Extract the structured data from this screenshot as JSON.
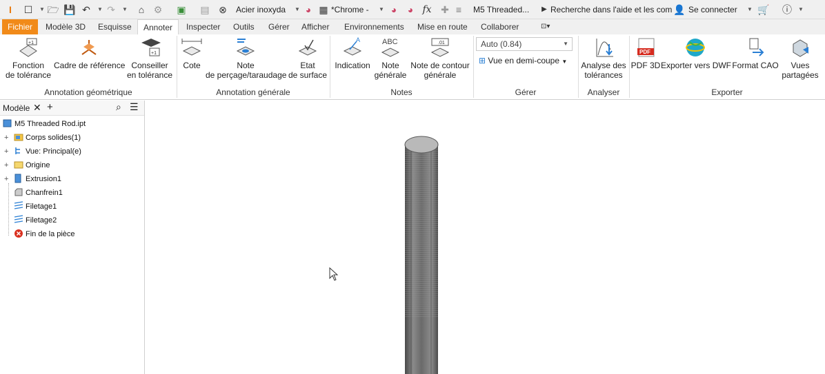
{
  "app": {
    "material": "Acier inoxyda",
    "appearance": "*Chrome -",
    "document_title": "M5 Threaded...",
    "search_placeholder": "Recherche dans l'aide et les com",
    "sign_in": "Se connecter"
  },
  "tabs": [
    "Fichier",
    "Modèle 3D",
    "Esquisse",
    "Annoter",
    "Inspecter",
    "Outils",
    "Gérer",
    "Afficher",
    "Environnements",
    "Mise en route",
    "Collaborer"
  ],
  "active_tab": "Annoter",
  "ribbon": {
    "annotation_geometrique": {
      "title": "Annotation géométrique",
      "buttons": [
        {
          "label1": "Fonction",
          "label2": "de tolérance",
          "icon": "feature-tolerance-icon"
        },
        {
          "label1": "Cadre de référence",
          "label2": "",
          "icon": "datum-frame-icon"
        },
        {
          "label1": "Conseiller",
          "label2": "en tolérance",
          "icon": "tolerance-advisor-icon"
        }
      ]
    },
    "annotation_generale": {
      "title": "Annotation générale",
      "buttons": [
        {
          "label1": "Cote",
          "label2": "",
          "icon": "dimension-icon"
        },
        {
          "label1": "Note",
          "label2": "de perçage/taraudage",
          "icon": "hole-note-icon"
        },
        {
          "label1": "Etat",
          "label2": "de surface",
          "icon": "surface-texture-icon"
        }
      ]
    },
    "notes": {
      "title": "Notes",
      "buttons": [
        {
          "label1": "Indication",
          "label2": "",
          "icon": "leader-text-icon"
        },
        {
          "label1": "Note",
          "label2": "générale",
          "icon": "general-note-icon"
        },
        {
          "label1": "Note de contour",
          "label2": "générale",
          "icon": "contour-note-icon"
        }
      ]
    },
    "gerer": {
      "title": "Gérer",
      "auto_select": "Auto (0.84)",
      "view_option": "Vue en demi-coupe"
    },
    "analyser": {
      "title": "Analyser",
      "buttons": [
        {
          "label1": "Analyse des",
          "label2": "tolérances",
          "icon": "tolerance-analysis-icon"
        }
      ]
    },
    "exporter": {
      "title": "Exporter",
      "buttons": [
        {
          "label1": "PDF 3D",
          "label2": "",
          "icon": "pdf-icon"
        },
        {
          "label1": "Exporter vers DWF",
          "label2": "",
          "icon": "dwf-globe-icon"
        },
        {
          "label1": "Format CAO",
          "label2": "",
          "icon": "cad-format-icon"
        },
        {
          "label1": "Vues",
          "label2": "partagées",
          "icon": "shared-views-icon"
        }
      ]
    }
  },
  "browser": {
    "tab_label": "Modèle",
    "root": "M5 Threaded Rod.ipt",
    "nodes": [
      {
        "label": "Corps solides(1)",
        "expandable": true,
        "icon": "folder-icon"
      },
      {
        "label": "Vue: Principal(e)",
        "expandable": true,
        "icon": "view-rep-icon"
      },
      {
        "label": "Origine",
        "expandable": true,
        "icon": "folder-icon"
      },
      {
        "label": "Extrusion1",
        "expandable": true,
        "icon": "extrusion-icon"
      },
      {
        "label": "Chanfrein1",
        "expandable": false,
        "icon": "chamfer-icon"
      },
      {
        "label": "Filetage1",
        "expandable": false,
        "icon": "thread-icon"
      },
      {
        "label": "Filetage2",
        "expandable": false,
        "icon": "thread-icon"
      },
      {
        "label": "Fin de la pièce",
        "expandable": false,
        "icon": "end-of-part-icon"
      }
    ]
  },
  "colors": {
    "file_tab": "#f18a19",
    "rod": "#6e6e6e"
  }
}
